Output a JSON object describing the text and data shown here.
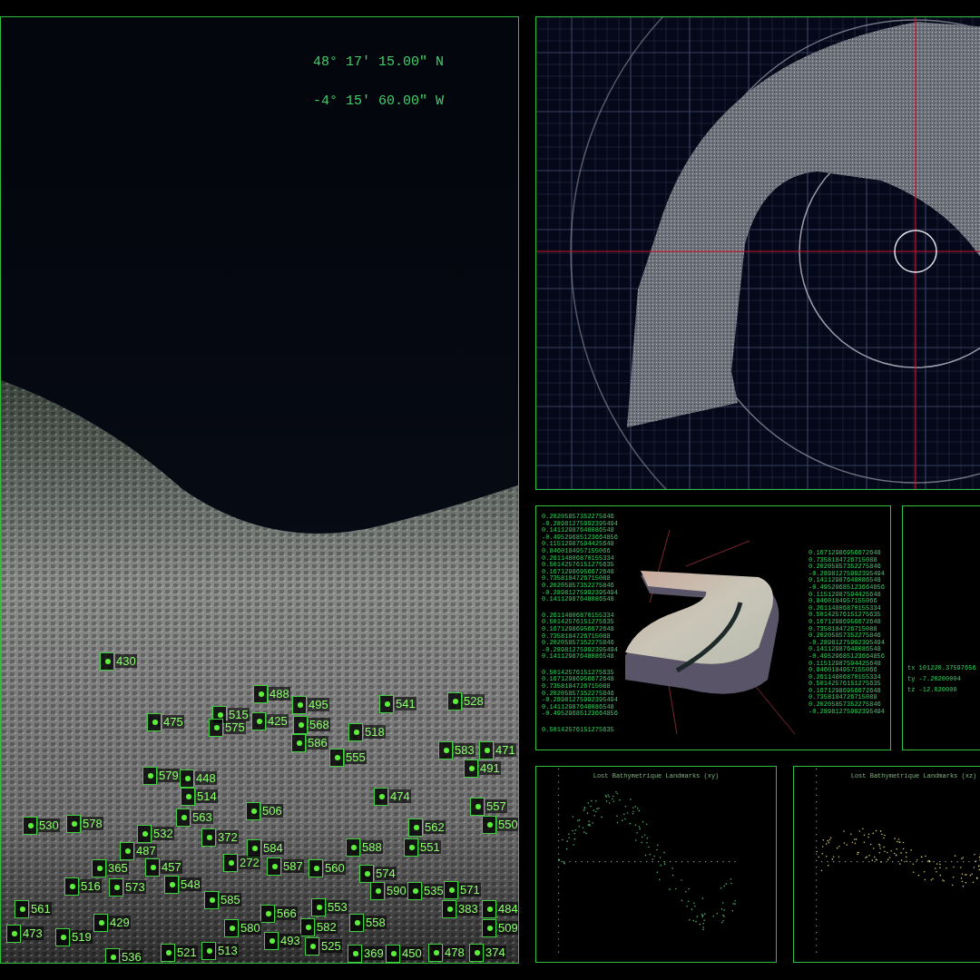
{
  "coordinates": [
    "48° 17' 15.00\" N",
    "-4° 15' 60.00\" W"
  ],
  "landmarks": [
    {
      "label": "430"
    },
    {
      "label": "488"
    },
    {
      "label": "495"
    },
    {
      "label": "541"
    },
    {
      "label": "528"
    },
    {
      "label": "475"
    },
    {
      "label": "515"
    },
    {
      "label": "575"
    },
    {
      "label": "425"
    },
    {
      "label": "568"
    },
    {
      "label": "518"
    },
    {
      "label": "586"
    },
    {
      "label": "555"
    },
    {
      "label": "583"
    },
    {
      "label": "471"
    },
    {
      "label": "491"
    },
    {
      "label": "579"
    },
    {
      "label": "448"
    },
    {
      "label": "514"
    },
    {
      "label": "474"
    },
    {
      "label": "530"
    },
    {
      "label": "578"
    },
    {
      "label": "563"
    },
    {
      "label": "506"
    },
    {
      "label": "562"
    },
    {
      "label": "557"
    },
    {
      "label": "550"
    },
    {
      "label": "532"
    },
    {
      "label": "372"
    },
    {
      "label": "487"
    },
    {
      "label": "584"
    },
    {
      "label": "588"
    },
    {
      "label": "551"
    },
    {
      "label": "365"
    },
    {
      "label": "457"
    },
    {
      "label": "272"
    },
    {
      "label": "587"
    },
    {
      "label": "560"
    },
    {
      "label": "574"
    },
    {
      "label": "516"
    },
    {
      "label": "573"
    },
    {
      "label": "548"
    },
    {
      "label": "590"
    },
    {
      "label": "535"
    },
    {
      "label": "571"
    },
    {
      "label": "561"
    },
    {
      "label": "585"
    },
    {
      "label": "566"
    },
    {
      "label": "553"
    },
    {
      "label": "383"
    },
    {
      "label": "484"
    },
    {
      "label": "429"
    },
    {
      "label": "580"
    },
    {
      "label": "582"
    },
    {
      "label": "558"
    },
    {
      "label": "509"
    },
    {
      "label": "473"
    },
    {
      "label": "519"
    },
    {
      "label": "493"
    },
    {
      "label": "525"
    },
    {
      "label": "536"
    },
    {
      "label": "521"
    },
    {
      "label": "513"
    },
    {
      "label": "369"
    },
    {
      "label": "450"
    },
    {
      "label": "478"
    },
    {
      "label": "374"
    }
  ],
  "data_panel": {
    "left_groups": [
      [
        "0.20205857352275846",
        "-0.28981275992395494",
        "0.14112987648086548",
        "-0.49529685123664856",
        "0.11512987594425648",
        "0.8460184957155066",
        "0.26114806870155334",
        "0.50142576151275635",
        "0.16712986956672648",
        "0.7358184726715088",
        "0.20205857352275846",
        "-0.28981275992395494",
        "0.14112987648086548"
      ],
      [
        "0.26114806870155334",
        "0.50142576151275635",
        "0.16712986956672648",
        "0.7358184726715088",
        "0.20205857352275846",
        "-0.28981275992395494",
        "0.14112987648086548"
      ],
      [
        "0.50142576151275635",
        "0.16712986956672648",
        "0.7358184726715088",
        "0.20205857352275846",
        "-0.28981275992395494",
        "0.14112987648086548",
        "-0.49529685123664856"
      ],
      [
        "0.50142576151275635"
      ]
    ],
    "right_column": [
      "0.16712986956672648",
      "0.7358184726715088",
      "0.20205857352275846",
      "-0.28981275992395494",
      "0.14112987648086548",
      "-0.49529685123664856",
      "0.11512987594425648",
      "0.8460184957155066",
      "0.26114806870155334",
      "0.50142576151275635",
      "0.16712986956672648",
      "0.7358184726715088",
      "0.20205857352275846",
      "-0.28981275992395494",
      "0.14112987648086548",
      "-0.49529685123664856",
      "0.11512987594425648",
      "0.8460184957155066",
      "0.26114806870155334",
      "0.50142576151275635",
      "0.16712986956672648",
      "0.7358184726715088",
      "0.20205857352275846",
      "-0.28981275992395494"
    ]
  },
  "transform_panel": {
    "lines": [
      "tx 101220.37597656",
      "ty -7.20200004",
      "tz -12.020000"
    ]
  },
  "plots": [
    {
      "title": "Lost Bathymetrique Landmarks (xy)"
    },
    {
      "title": "Lost Bathymetrique Landmarks (xz)"
    }
  ]
}
